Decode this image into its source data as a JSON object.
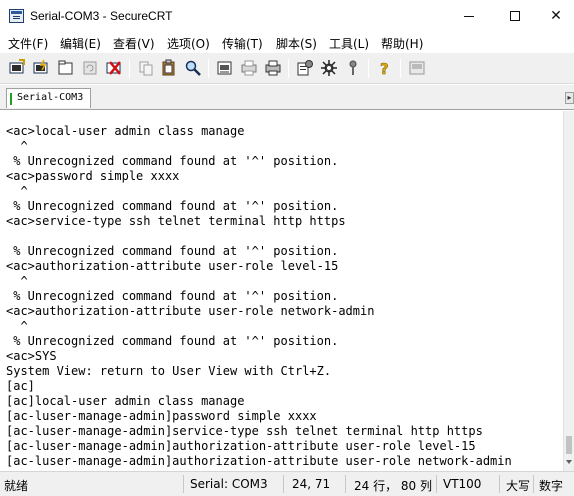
{
  "window": {
    "title": "Serial-COM3 - SecureCRT",
    "minimize_glyph": "",
    "close_glyph": "✕"
  },
  "menu": [
    "文件(F)",
    "编辑(E)",
    "查看(V)",
    "选项(O)",
    "传输(T)",
    "脚本(S)",
    "工具(L)",
    "帮助(H)"
  ],
  "toolbar": {
    "icons": [
      "connect-icon",
      "quick-connect-icon",
      "connect-tab-icon",
      "reconnect-icon",
      "disconnect-icon",
      "copy-icon",
      "paste-icon",
      "find-icon",
      "print-setup-icon",
      "print-selection-icon",
      "print-icon",
      "session-options-icon",
      "global-options-icon",
      "keymap-icon",
      "help-icon",
      "sftp-icon"
    ]
  },
  "tab": {
    "label": "Serial-COM3",
    "status_color": "#1da11d",
    "scroll_glyph": "▸"
  },
  "terminal": {
    "lines": [
      "<ac>local-user admin class manage",
      "  ^",
      " % Unrecognized command found at '^' position.",
      "<ac>password simple xxxx",
      "  ^",
      " % Unrecognized command found at '^' position.",
      "<ac>service-type ssh telnet terminal http https",
      "",
      " % Unrecognized command found at '^' position.",
      "<ac>authorization-attribute user-role level-15",
      "  ^",
      " % Unrecognized command found at '^' position.",
      "<ac>authorization-attribute user-role network-admin",
      "  ^",
      " % Unrecognized command found at '^' position.",
      "<ac>SYS",
      "System View: return to User View with Ctrl+Z.",
      "[ac]",
      "[ac]local-user admin class manage",
      "[ac-luser-manage-admin]password simple xxxx",
      "[ac-luser-manage-admin]service-type ssh telnet terminal http https",
      "[ac-luser-manage-admin]authorization-attribute user-role level-15",
      "[ac-luser-manage-admin]authorization-attribute user-role network-admin"
    ]
  },
  "statusbar": {
    "ready": "就绪",
    "connection": "Serial: COM3",
    "cursor": "24,  71",
    "size": "24 行， 80 列",
    "emulation": "VT100",
    "caps": "大写",
    "num": "数字"
  }
}
